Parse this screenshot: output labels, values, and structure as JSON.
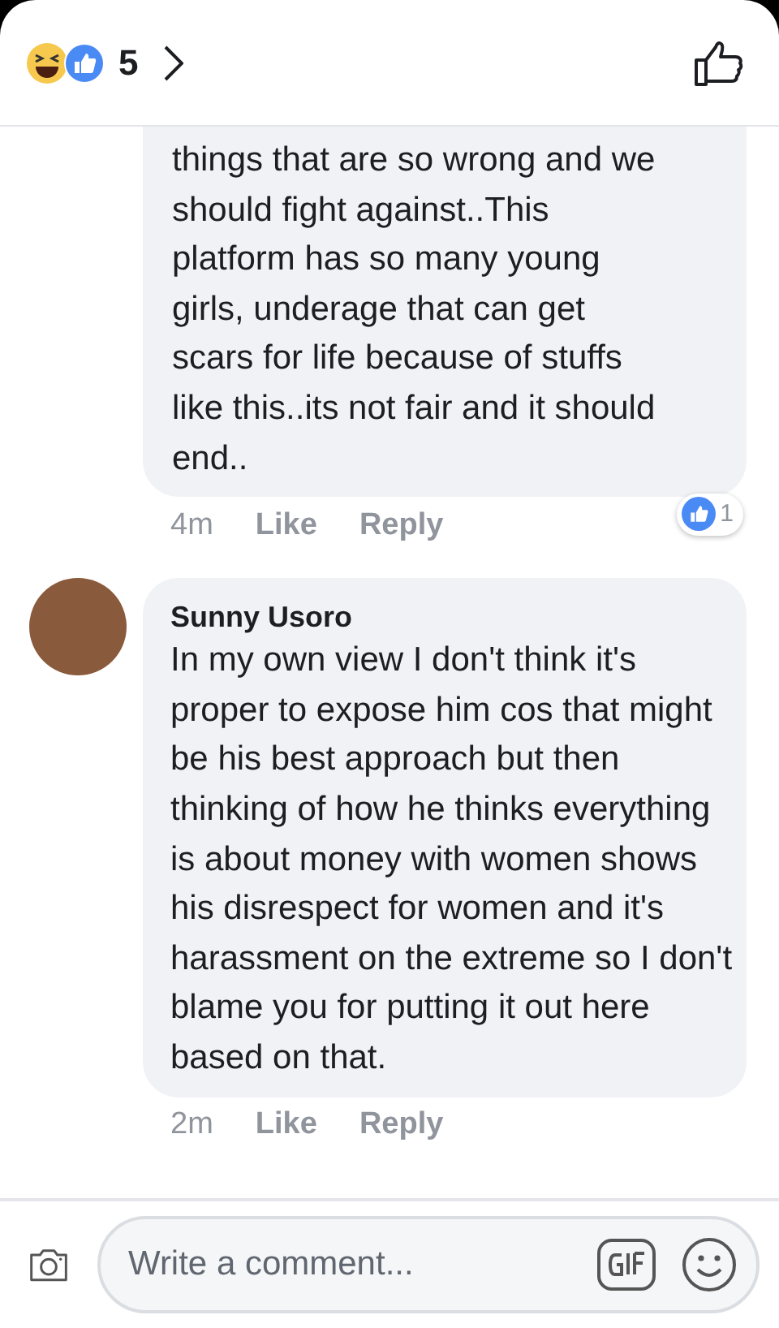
{
  "reactions_bar": {
    "count": "5"
  },
  "comments": [
    {
      "text": "things that are so wrong and we should fight against..This platform has so many young girls, underage that can get scars for life because of stuffs like this..its not fair and it should end..",
      "time": "4m",
      "like": "Like",
      "reply": "Reply",
      "reaction_count": "1"
    },
    {
      "author": "Sunny Usoro",
      "text": "In my own view I don't think it's proper to expose him cos that might be his best approach but then thinking of how he thinks everything is about money with women shows his disrespect for women and it's harassment on the extreme so I don't blame you for putting it out here based on that.",
      "time": "2m",
      "like": "Like",
      "reply": "Reply"
    }
  ],
  "composer": {
    "placeholder": "Write a comment..."
  }
}
